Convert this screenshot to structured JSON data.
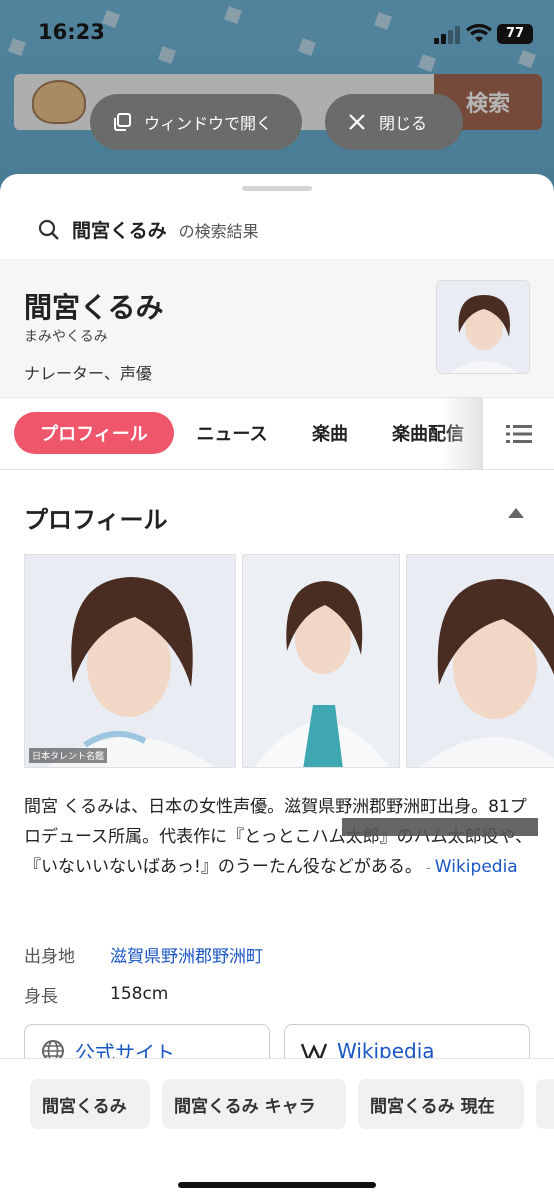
{
  "status": {
    "time": "16:23",
    "battery": "77"
  },
  "background": {
    "search_button": "検索"
  },
  "overlay": {
    "open_window_label": "ウィンドウで開く",
    "close_label": "閉じる"
  },
  "search": {
    "query": "間宮くるみ",
    "suffix": "の検索結果"
  },
  "entity": {
    "name": "間宮くるみ",
    "reading": "まみやくるみ",
    "occupation": "ナレーター、声優",
    "photo_credit": "日本タレント名鑑"
  },
  "tabs": [
    {
      "label": "プロフィール",
      "active": true
    },
    {
      "label": "ニュース",
      "active": false
    },
    {
      "label": "楽曲",
      "active": false
    },
    {
      "label": "楽曲配信",
      "active": false
    }
  ],
  "profile": {
    "title": "プロフィール",
    "description": "間宮 くるみは、日本の女性声優。滋賀県野洲郡野洲町出身。81プロデュース所属。代表作に『とっとこハム太郎』のハム太郎役や、『いないいないばあっ!』のうーたん役などがある。",
    "source_sep": " - ",
    "source": "Wikipedia",
    "facts": [
      {
        "label": "出身地",
        "value": "滋賀県野洲郡野洲町",
        "is_link": true
      },
      {
        "label": "身長",
        "value": "158cm",
        "is_link": false
      }
    ],
    "links": [
      {
        "label": "公式サイト"
      },
      {
        "label": "Wikipedia"
      }
    ]
  },
  "related": [
    "間宮くるみ",
    "間宮くるみ キャラ",
    "間宮くるみ 現在"
  ],
  "colors": {
    "accent": "#f0566b",
    "link": "#1a56c4"
  }
}
